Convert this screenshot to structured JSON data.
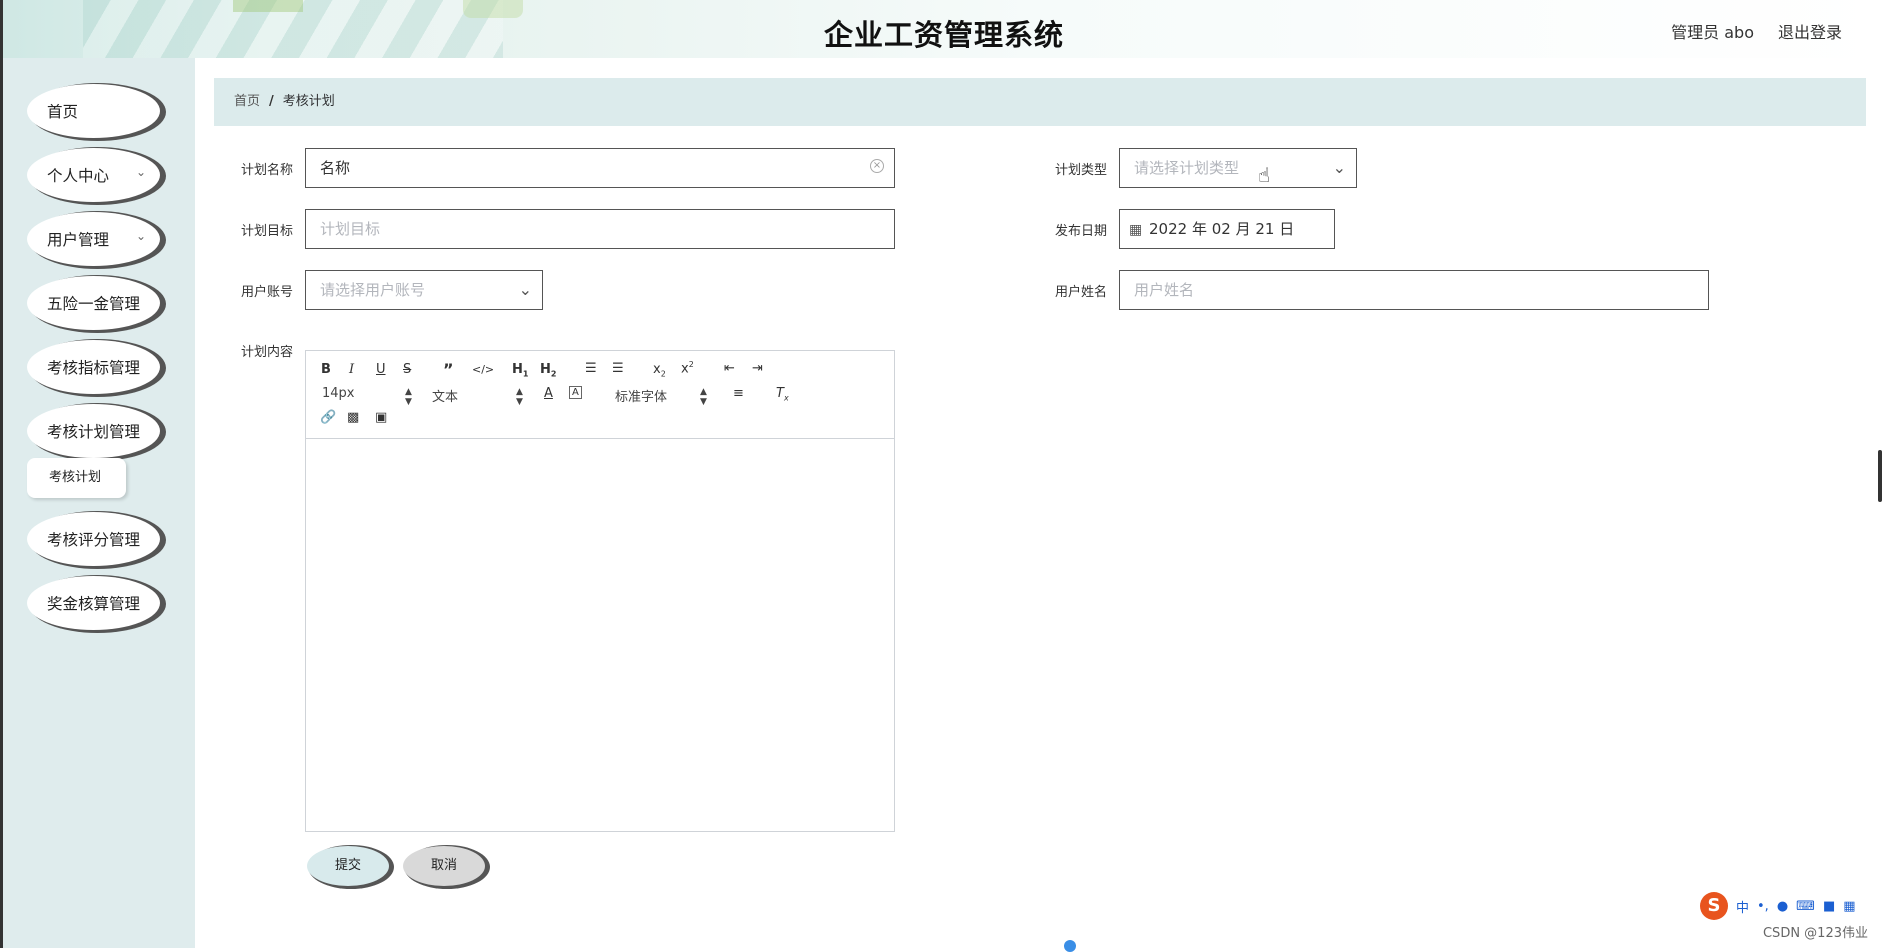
{
  "header": {
    "title": "企业工资管理系统",
    "admin": "管理员 abo",
    "logout": "退出登录"
  },
  "sidebar": {
    "items": [
      {
        "label": "首页"
      },
      {
        "label": "个人中心"
      },
      {
        "label": "用户管理"
      },
      {
        "label": "五险一金管理"
      },
      {
        "label": "考核指标管理"
      },
      {
        "label": "考核计划管理"
      },
      {
        "label": "考核评分管理"
      },
      {
        "label": "奖金核算管理"
      }
    ],
    "sub_item": "考核计划"
  },
  "breadcrumb": {
    "home": "首页",
    "separator": "/",
    "current": "考核计划"
  },
  "form": {
    "plan_name": {
      "label": "计划名称",
      "value": "名称"
    },
    "plan_type": {
      "label": "计划类型",
      "placeholder": "请选择计划类型"
    },
    "plan_goal": {
      "label": "计划目标",
      "placeholder": "计划目标"
    },
    "publish_date": {
      "label": "发布日期",
      "value": "2022 年 02 月 21 日"
    },
    "user_account": {
      "label": "用户账号",
      "placeholder": "请选择用户账号"
    },
    "user_name": {
      "label": "用户姓名",
      "placeholder": "用户姓名"
    },
    "plan_content": {
      "label": "计划内容"
    }
  },
  "editor": {
    "font_size": "14px",
    "header_select": "文本",
    "font_family": "标准字体"
  },
  "buttons": {
    "submit": "提交",
    "cancel": "取消"
  },
  "ime": {
    "lang": "中"
  },
  "watermark": "CSDN @123伟业"
}
